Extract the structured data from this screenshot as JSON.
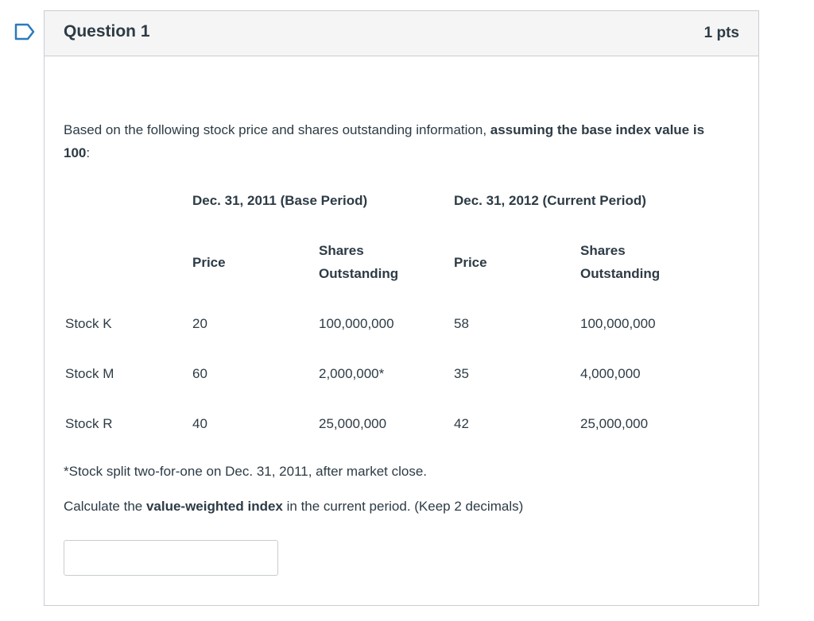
{
  "question": {
    "title": "Question 1",
    "points": "1 pts",
    "intro_plain": "Based on the following stock price and shares outstanding information, ",
    "intro_bold": "assuming the base index value is 100",
    "intro_end": ":",
    "table": {
      "group_headers": [
        "Dec. 31, 2011 (Base Period)",
        "Dec. 31, 2012 (Current Period)"
      ],
      "col_price": "Price",
      "col_shares_line1": "Shares",
      "col_shares_line2": "Outstanding",
      "rows": [
        {
          "stock": "Stock K",
          "base_price": "20",
          "base_shares": "100,000,000",
          "cur_price": "58",
          "cur_shares": "100,000,000"
        },
        {
          "stock": "Stock M",
          "base_price": "60",
          "base_shares": "2,000,000*",
          "cur_price": "35",
          "cur_shares": "4,000,000"
        },
        {
          "stock": "Stock R",
          "base_price": "40",
          "base_shares": "25,000,000",
          "cur_price": "42",
          "cur_shares": "25,000,000"
        }
      ]
    },
    "footnote": "*Stock split two-for-one on Dec. 31, 2011, after market close.",
    "prompt_pre": "Calculate the ",
    "prompt_bold": "value-weighted index",
    "prompt_post": " in the current period. (Keep 2 decimals)",
    "answer_value": ""
  },
  "colors": {
    "text": "#2d3b45",
    "border": "#c7cdd1",
    "header_bg": "#f5f5f5",
    "flag": "#2b7abc"
  },
  "icons": {
    "flag": "bookmark-flag-icon"
  }
}
